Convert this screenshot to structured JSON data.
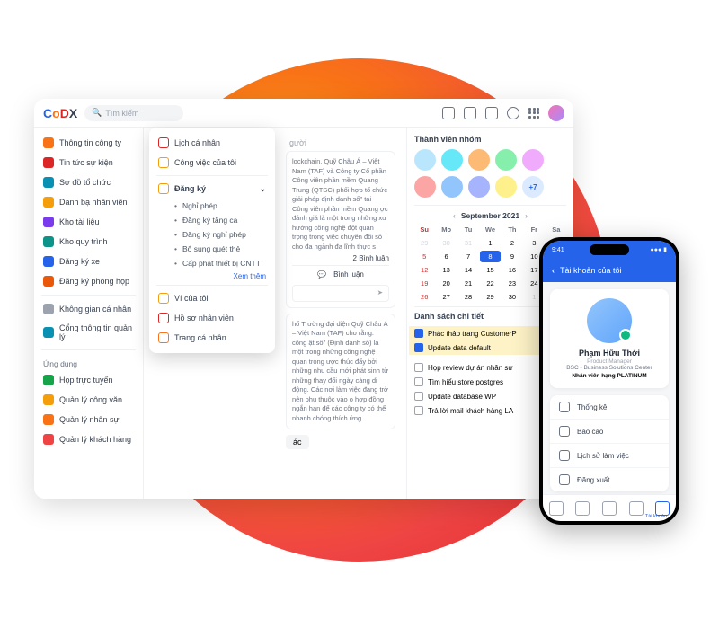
{
  "header": {
    "logo": "CoDX",
    "search_placeholder": "Tìm kiếm"
  },
  "sidebar": {
    "items": [
      {
        "label": "Thông tin công ty",
        "color": "#f97316"
      },
      {
        "label": "Tin tức sự kiện",
        "color": "#dc2626"
      },
      {
        "label": "Sơ đồ tổ chức",
        "color": "#0891b2"
      },
      {
        "label": "Danh bạ nhân viên",
        "color": "#f59e0b"
      },
      {
        "label": "Kho tài liệu",
        "color": "#7c3aed"
      },
      {
        "label": "Kho quy trình",
        "color": "#0d9488"
      },
      {
        "label": "Đăng ký xe",
        "color": "#2563eb"
      },
      {
        "label": "Đăng ký phòng họp",
        "color": "#ea580c"
      }
    ],
    "items2": [
      {
        "label": "Không gian cá nhân",
        "color": "#9ca3af"
      },
      {
        "label": "Cổng thông tin quản lý",
        "color": "#0891b2"
      }
    ],
    "apps_header": "Ứng dụng",
    "apps": [
      {
        "label": "Họp trực tuyến",
        "color": "#16a34a"
      },
      {
        "label": "Quản lý công văn",
        "color": "#f59e0b"
      },
      {
        "label": "Quản lý nhân sự",
        "color": "#f97316"
      },
      {
        "label": "Quản lý khách hàng",
        "color": "#ef4444"
      }
    ]
  },
  "dropdown": {
    "items": [
      {
        "label": "Lịch cá nhân",
        "color": "#dc2626"
      },
      {
        "label": "Công việc của tôi",
        "color": "#f59e0b"
      }
    ],
    "expand_label": "Đăng ký",
    "sub": [
      "Nghỉ phép",
      "Đăng ký tăng ca",
      "Đăng ký nghỉ phép",
      "Bổ sung quét thẻ",
      "Cấp phát thiết bị CNTT"
    ],
    "see_more": "Xem thêm",
    "items3": [
      {
        "label": "Ví của tôi",
        "color": "#f59e0b"
      },
      {
        "label": "Hồ sơ nhân viên",
        "color": "#dc2626"
      },
      {
        "label": "Trang cá nhân",
        "color": "#f97316"
      }
    ]
  },
  "feed": {
    "tab_hint": "gười",
    "post1": "lockchain, Quỹ Châu Á – Việt Nam (TAF) và Công ty Cổ phần Công viên phần mềm Quang Trung (QTSC) phối hợp tổ chức giải pháp định danh số\" tại Công viên phần mềm Quang ợc đánh giá là một trong những xu hướng công nghệ đột quan trọng trong việc chuyển đổi số cho đa ngành đa lĩnh thực s",
    "comments_count": "2 Bình luận",
    "comment_label": "Bình luận",
    "post2": "hổ Trường đại diện Quỹ Châu Á – Việt Nam (TAF) cho rằng: công ật số\" (Định danh số) là một trong những công nghệ quan trong ược thúc đẩy bởi những nhu cầu mới phát sinh từ những thay đổi ngày càng di động. Các nơi làm việc đang trở nên phụ thuộc vào o hợp đồng ngắn hạn để các công ty có thể nhanh chóng thích ứng",
    "btn": "ác"
  },
  "right": {
    "members_title": "Thành viên nhóm",
    "more": "+7",
    "avatar_colors": [
      "#bae6fd",
      "#67e8f9",
      "#fdba74",
      "#86efac",
      "#f0abfc",
      "#fca5a5",
      "#93c5fd",
      "#a5b4fc",
      "#fef08a"
    ],
    "cal_title": "September 2021",
    "dow": [
      "Su",
      "Mo",
      "Tu",
      "We",
      "Th",
      "Fr",
      "Sa"
    ],
    "tasks_title": "Danh sách chi tiết",
    "tasks_done": [
      "Phác thảo trang CustomerP",
      "Update data default"
    ],
    "tasks_todo": [
      "Họp review dự án nhân sự",
      "Tìm hiểu store postgres",
      "Update database WP",
      "Trả lời mail khách hàng LA"
    ]
  },
  "phone": {
    "time": "9:41",
    "title": "Tài khoản của tôi",
    "name": "Phạm Hữu Thới",
    "role": "Product Manager",
    "org": "BSC - Business Solutions Center",
    "badge": "Nhân viên hạng PLATINUM",
    "menu": [
      "Thống kê",
      "Báo cáo",
      "Lịch sử làm việc",
      "Đăng xuất"
    ],
    "nav_label": "Tài khoản"
  }
}
